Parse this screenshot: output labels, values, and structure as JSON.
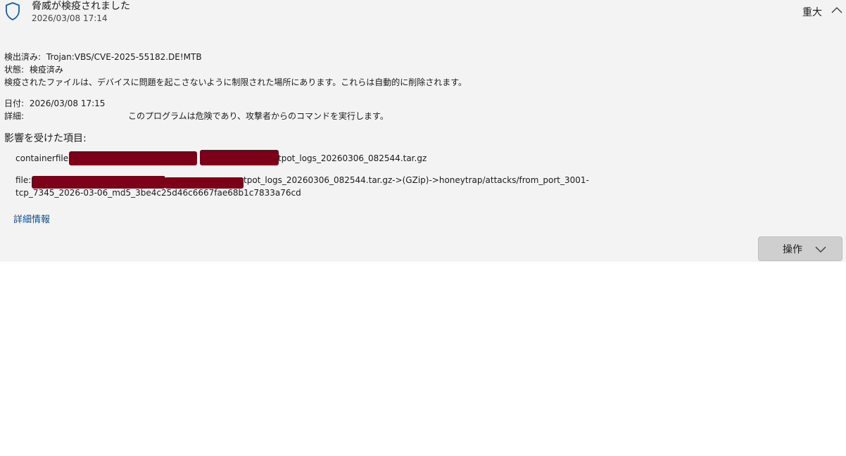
{
  "alert": {
    "title": "脅威が検疫されました",
    "timestamp": "2026/03/08 17:14",
    "severity": "重大"
  },
  "details": {
    "detected_label": "検出済み:",
    "detected_value": "Trojan:VBS/CVE-2025-55182.DE!MTB",
    "status_label": "状態:",
    "status_value": "検疫済み",
    "quarantine_note": "検疫されたファイルは、デバイスに問題を起こさないように制限された場所にあります。これらは自動的に削除されます。",
    "date_label": "日付:",
    "date_value": "2026/03/08 17:15",
    "detail_label": "詳細:",
    "detail_value": "このプログラムは危険であり、攻撃者からのコマンドを実行します。"
  },
  "affected": {
    "heading": "影響を受けた項目:",
    "containerfile_label": "containerfile:",
    "containerfile_value": "tpot_logs_20260306_082544.tar.gz",
    "file_label": "file:",
    "file_value_line1": "tpot_logs_20260306_082544.tar.gz->(GZip)->honeytrap/attacks/from_port_3001-",
    "file_value_line2": "tcp_7345_2026-03-06_md5_3be4c25d46c6667fae68b1c7833a76cd"
  },
  "more_info_link": "詳細情報",
  "actions_button": "操作",
  "colors": {
    "panel_bg": "#f3f3f3",
    "link": "#0a4f99",
    "shield": "#0a5fb4",
    "redaction": "#7d0019"
  }
}
